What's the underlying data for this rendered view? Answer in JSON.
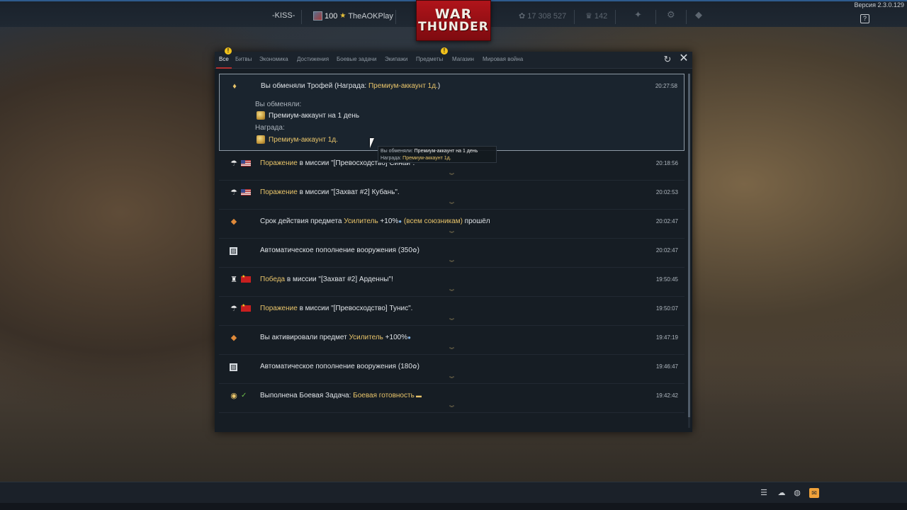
{
  "topbar": {
    "version": "Версия 2.3.0.129",
    "squad_tag": "-KISS-",
    "level": "100",
    "nickname": "TheAOKPlay",
    "silver_lions": "17 308 527",
    "golden_eagles": "142",
    "help": "?"
  },
  "logo": {
    "line1": "WAR",
    "line2": "THUNDER"
  },
  "window": {
    "tabs": [
      {
        "label": "Все",
        "active": true,
        "warning": true
      },
      {
        "label": "Битвы"
      },
      {
        "label": "Экономика"
      },
      {
        "label": "Достижения"
      },
      {
        "label": "Боевые задачи"
      },
      {
        "label": "Экипажи"
      },
      {
        "label": "Предметы",
        "warning": true
      },
      {
        "label": "Магазин"
      },
      {
        "label": "Мировая война"
      }
    ],
    "warning_symbol": "!",
    "refresh_icon": "↻",
    "close_icon": "✕"
  },
  "expanded": {
    "title_a": "Вы обменяли Трофей ",
    "title_b": "(Награда: ",
    "title_hl": "Премиум-аккаунт 1д.",
    "title_c": ")",
    "time": "20:27:58",
    "exchanged_label": "Вы обменяли:",
    "exchanged_item": "Премиум-аккаунт на 1 день",
    "reward_label": "Награда:",
    "reward_item": "Премиум-аккаунт 1д."
  },
  "rows": [
    {
      "hl": "Поражение",
      "rest": " в миссии \"[Превосходство] Синай\".",
      "time": "20:18:56",
      "icon": "parachute",
      "flag": "us"
    },
    {
      "hl": "Поражение",
      "rest": " в миссии \"[Захват #2] Кубань\".",
      "time": "20:02:53",
      "icon": "parachute",
      "flag": "us"
    },
    {
      "pre": "Срок действия предмета ",
      "hl": "Усилитель",
      "rest": " +10%",
      "hl2": " (всем союзникам)",
      "post": " прошёл",
      "time": "20:02:47",
      "icon": "booster"
    },
    {
      "pre": "Автоматическое пополнение вооружения (350",
      "post": ")",
      "time": "20:02:47",
      "icon": "ammo",
      "silver": true
    },
    {
      "hl": "Победа",
      "rest": " в миссии \"[Захват #2] Арденны\"!",
      "time": "19:50:45",
      "icon": "trophy",
      "flag": "cn"
    },
    {
      "hl": "Поражение",
      "rest": " в миссии \"[Превосходство] Тунис\".",
      "time": "19:50:07",
      "icon": "parachute",
      "flag": "cn"
    },
    {
      "pre": "Вы активировали предмет ",
      "hl": "Усилитель",
      "rest": " +100%",
      "time": "19:47:19",
      "icon": "booster"
    },
    {
      "pre": "Автоматическое пополнение вооружения (180",
      "post": ")",
      "time": "19:46:47",
      "icon": "ammo",
      "silver": true
    },
    {
      "pre": "Выполнена Боевая Задача: ",
      "hl": "Боевая готовность",
      "time": "19:42:42",
      "icon": "eye",
      "check": true
    }
  ],
  "tooltip": {
    "line1_label": "Вы обменяли: ",
    "line1_value": "Премиум-аккаунт на 1 день",
    "line2_label": "Награда: ",
    "line2_value": "Премиум-аккаунт 1д."
  },
  "bottombar": {
    "icons": [
      "list-icon",
      "squad-icon",
      "chat-icon",
      "mail-icon"
    ]
  },
  "colors": {
    "highlight": "#e8c46a",
    "logo_red": "#b0141a",
    "mail": "#f0a23a"
  }
}
